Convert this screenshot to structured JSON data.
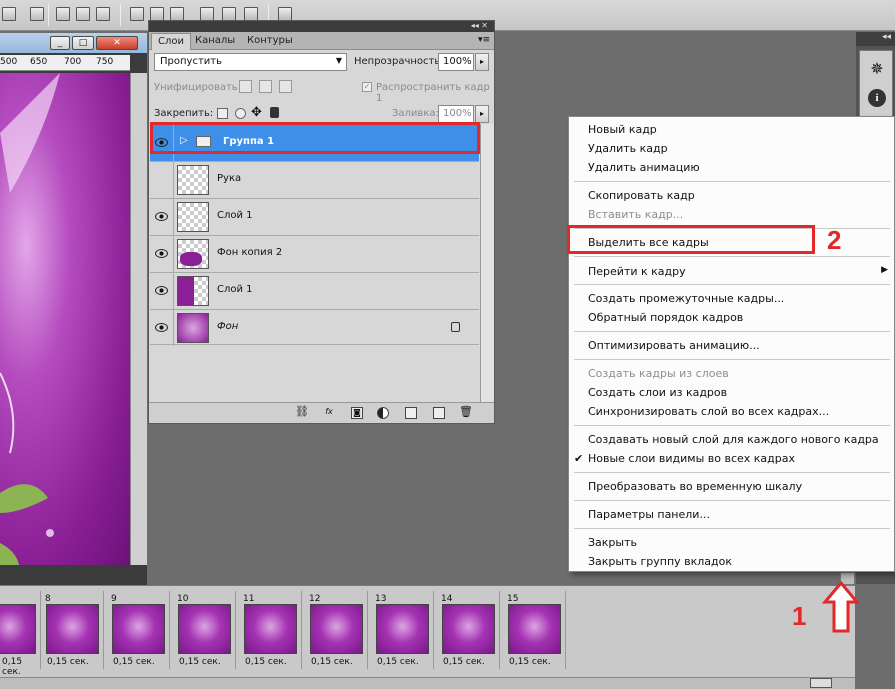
{
  "layers_panel": {
    "tabs": [
      "Слои",
      "Каналы",
      "Контуры"
    ],
    "blend_mode": "Пропустить",
    "opacity_label": "Непрозрачность:",
    "opacity_value": "100%",
    "unify_label": "Унифицировать:",
    "propagate_label": "Распространить кадр 1",
    "lock_label": "Закрепить:",
    "fill_label": "Заливка:",
    "fill_value": "100%",
    "layers": [
      {
        "name": "Группа 1",
        "visible": true,
        "selected": true
      },
      {
        "name": "Рука",
        "visible": false,
        "selected": false
      },
      {
        "name": "Слой 1",
        "visible": true,
        "selected": false
      },
      {
        "name": "Фон копия 2",
        "visible": true,
        "selected": false
      },
      {
        "name": "Слой 1",
        "visible": true,
        "selected": false
      },
      {
        "name": "Фон",
        "visible": true,
        "selected": false,
        "locked": true
      }
    ]
  },
  "ruler": {
    "ticks": [
      "500",
      "650",
      "700",
      "750"
    ]
  },
  "menu": {
    "items": [
      "Новый кадр",
      "Удалить кадр",
      "Удалить анимацию",
      "Скопировать кадр",
      "Вставить кадр...",
      "Выделить все кадры",
      "Перейти к кадру",
      "Создать промежуточные кадры...",
      "Обратный порядок кадров",
      "Оптимизировать анимацию...",
      "Создать кадры из слоев",
      "Создать слои из кадров",
      "Синхронизировать слой во всех кадрах...",
      "Создавать новый слой для каждого нового кадра",
      "Новые слои видимы во всех кадрах",
      "Преобразовать во временную шкалу",
      "Параметры панели...",
      "Закрыть",
      "Закрыть группу вкладок"
    ]
  },
  "animation": {
    "frames": [
      {
        "num": "",
        "time": "0,15 сек."
      },
      {
        "num": "8",
        "time": "0,15 сек."
      },
      {
        "num": "9",
        "time": "0,15 сек."
      },
      {
        "num": "10",
        "time": "0,15 сек."
      },
      {
        "num": "11",
        "time": "0,15 сек."
      },
      {
        "num": "12",
        "time": "0,15 сек."
      },
      {
        "num": "13",
        "time": "0,15 сек."
      },
      {
        "num": "14",
        "time": "0,15 сек."
      },
      {
        "num": "15",
        "time": "0,15 сек."
      }
    ]
  },
  "annotations": {
    "step1": "1",
    "step2": "2"
  },
  "colors": {
    "accent": "#3d8fe8",
    "annotation": "#e22828",
    "canvas": "#8a1f96"
  }
}
